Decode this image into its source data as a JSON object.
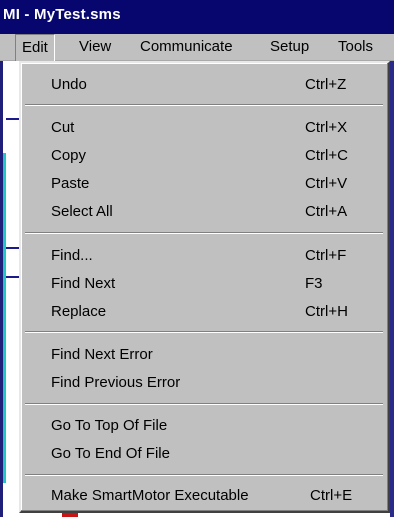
{
  "window": {
    "title": "MI - MyTest.sms"
  },
  "menubar": {
    "items": [
      {
        "label": "Edit"
      },
      {
        "label": "View"
      },
      {
        "label": "Communicate"
      },
      {
        "label": "Setup"
      },
      {
        "label": "Tools"
      }
    ]
  },
  "edit_menu": {
    "undo": {
      "label": "Undo",
      "shortcut": "Ctrl+Z"
    },
    "cut": {
      "label": "Cut",
      "shortcut": "Ctrl+X"
    },
    "copy": {
      "label": "Copy",
      "shortcut": "Ctrl+C"
    },
    "paste": {
      "label": "Paste",
      "shortcut": "Ctrl+V"
    },
    "select_all": {
      "label": "Select All",
      "shortcut": "Ctrl+A"
    },
    "find": {
      "label": "Find...",
      "shortcut": "Ctrl+F"
    },
    "find_next": {
      "label": "Find Next",
      "shortcut": "F3"
    },
    "replace": {
      "label": "Replace",
      "shortcut": "Ctrl+H"
    },
    "find_next_error": {
      "label": "Find Next Error"
    },
    "find_previous_error": {
      "label": "Find Previous Error"
    },
    "go_to_top": {
      "label": "Go To Top Of File"
    },
    "go_to_end": {
      "label": "Go To End Of File"
    },
    "make_executable": {
      "label": "Make SmartMotor Executable",
      "shortcut": "Ctrl+E"
    }
  },
  "colors": {
    "title_bar": "#06066e",
    "menu_face": "#c0c0c0",
    "accent_cyan": "#22c6c6"
  }
}
